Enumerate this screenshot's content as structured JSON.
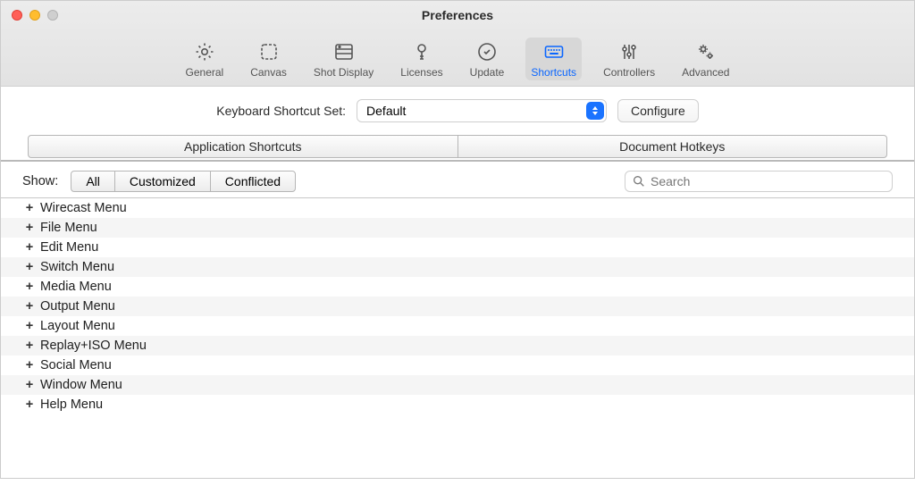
{
  "window": {
    "title": "Preferences"
  },
  "toolbar": {
    "items": [
      {
        "label": "General"
      },
      {
        "label": "Canvas"
      },
      {
        "label": "Shot Display"
      },
      {
        "label": "Licenses"
      },
      {
        "label": "Update"
      },
      {
        "label": "Shortcuts"
      },
      {
        "label": "Controllers"
      },
      {
        "label": "Advanced"
      }
    ],
    "selected_index": 5
  },
  "shortcut_set": {
    "label": "Keyboard Shortcut Set:",
    "value": "Default",
    "configure": "Configure"
  },
  "section_tabs": {
    "app": "Application Shortcuts",
    "doc": "Document Hotkeys"
  },
  "filter": {
    "label": "Show:",
    "all": "All",
    "customized": "Customized",
    "conflicted": "Conflicted"
  },
  "search": {
    "placeholder": "Search"
  },
  "menus": [
    {
      "label": "Wirecast Menu"
    },
    {
      "label": "File Menu"
    },
    {
      "label": "Edit Menu"
    },
    {
      "label": "Switch Menu"
    },
    {
      "label": "Media Menu"
    },
    {
      "label": "Output Menu"
    },
    {
      "label": "Layout Menu"
    },
    {
      "label": "Replay+ISO Menu"
    },
    {
      "label": "Social Menu"
    },
    {
      "label": "Window Menu"
    },
    {
      "label": "Help Menu"
    }
  ]
}
